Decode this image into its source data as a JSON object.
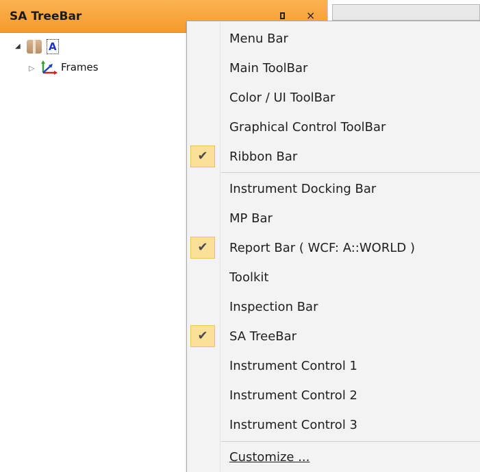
{
  "treebar": {
    "title": "SA TreeBar",
    "pin_icon": "pin-icon",
    "close_icon": "×",
    "tree": {
      "root_label": "A",
      "child_label": "Frames"
    }
  },
  "context_menu": {
    "items": [
      {
        "label": "Menu Bar",
        "checked": false
      },
      {
        "label": "Main ToolBar",
        "checked": false
      },
      {
        "label": "Color / UI ToolBar",
        "checked": false
      },
      {
        "label": "Graphical Control ToolBar",
        "checked": false
      },
      {
        "label": "Ribbon Bar",
        "checked": true
      },
      {
        "label": "Instrument Docking Bar",
        "checked": false
      },
      {
        "label": "MP Bar",
        "checked": false
      },
      {
        "label": "Report Bar ( WCF: A::WORLD )",
        "checked": true
      },
      {
        "label": "Toolkit",
        "checked": false
      },
      {
        "label": "Inspection Bar",
        "checked": false
      },
      {
        "label": "SA TreeBar",
        "checked": true
      },
      {
        "label": "Instrument Control 1",
        "checked": false
      },
      {
        "label": "Instrument Control 2",
        "checked": false
      },
      {
        "label": "Instrument Control 3",
        "checked": false
      },
      {
        "label": "Customize ...",
        "checked": false
      }
    ],
    "check_glyph": "✔"
  },
  "colors": {
    "header_orange": "#f69a2c",
    "check_highlight": "#fbe09a",
    "root_label_blue": "#1a32c8"
  }
}
